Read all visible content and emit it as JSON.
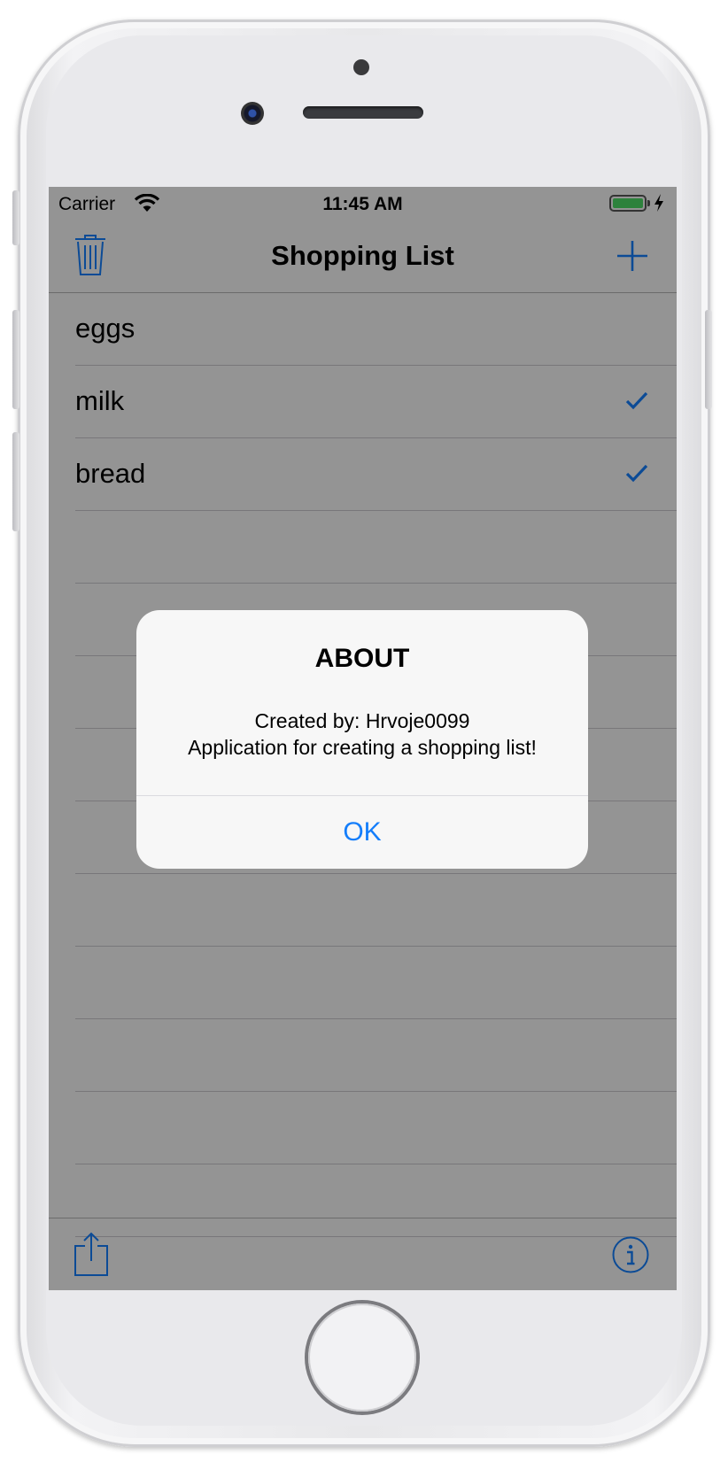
{
  "status_bar": {
    "carrier": "Carrier",
    "time": "11:45 AM",
    "battery_color": "#4cd964"
  },
  "nav_bar": {
    "title": "Shopping List",
    "left_icon": "trash-icon",
    "right_icon": "plus-icon"
  },
  "items": [
    {
      "label": "eggs",
      "checked": false
    },
    {
      "label": "milk",
      "checked": true
    },
    {
      "label": "bread",
      "checked": true
    }
  ],
  "toolbar": {
    "left_icon": "share-icon",
    "right_icon": "info-icon"
  },
  "alert": {
    "title": "ABOUT",
    "message_line1": "Created by: Hrvoje0099",
    "message_line2": "Application for creating a shopping list!",
    "ok_label": "OK",
    "ok_color": "#147efb"
  }
}
